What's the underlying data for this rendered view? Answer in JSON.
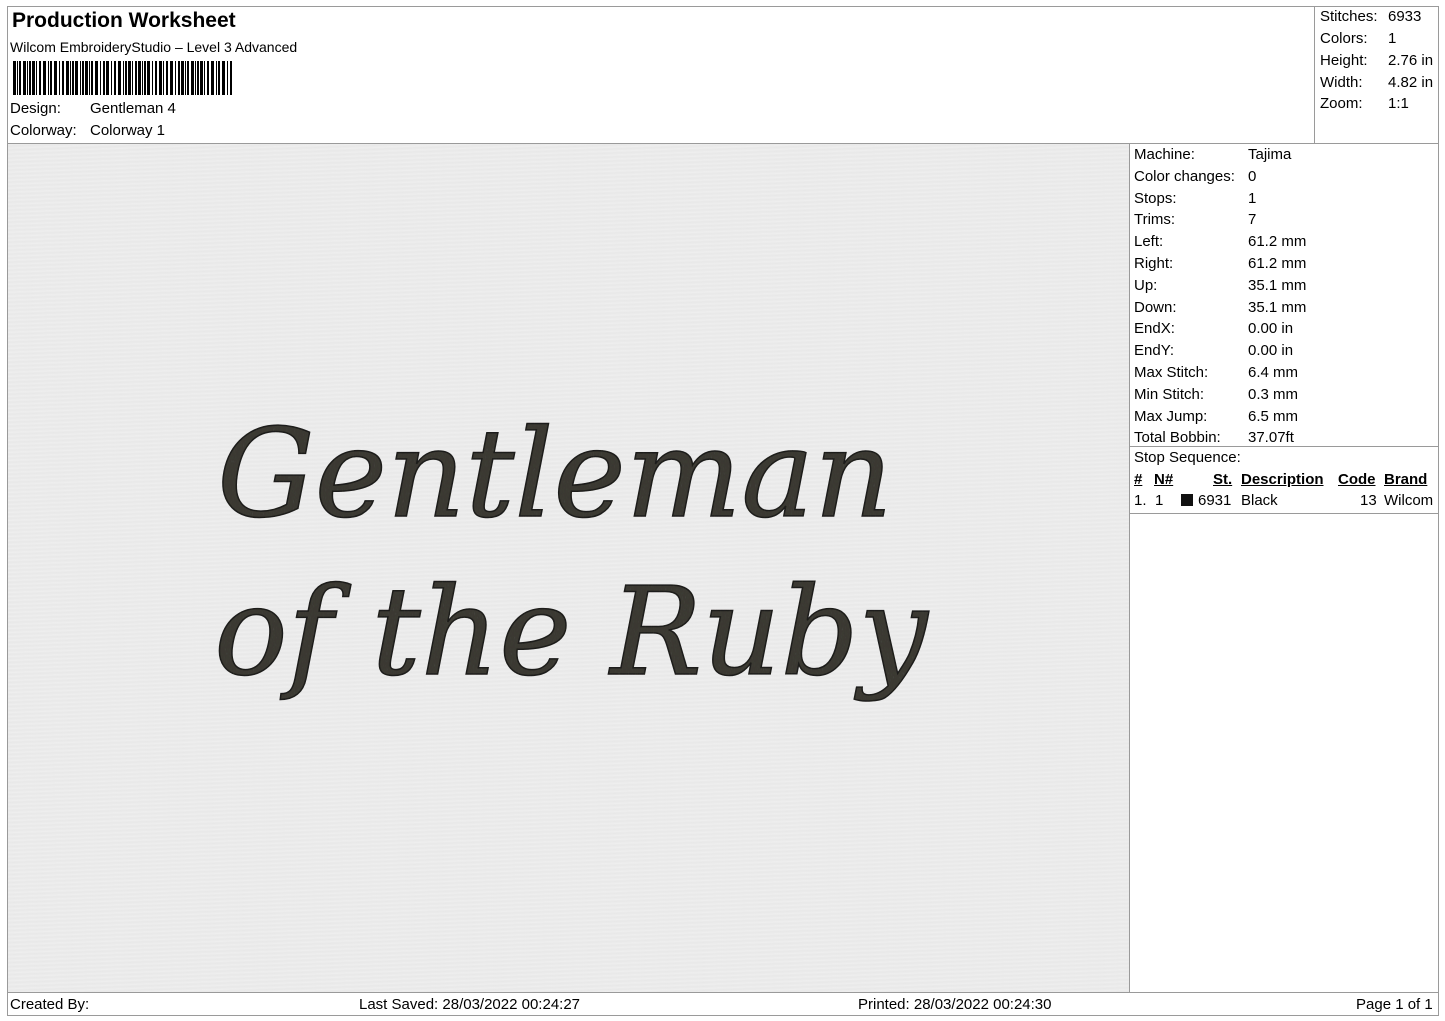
{
  "header": {
    "title": "Production Worksheet",
    "software": "Wilcom EmbroideryStudio – Level 3 Advanced",
    "design_label": "Design:",
    "design_value": "Gentleman 4",
    "colorway_label": "Colorway:",
    "colorway_value": "Colorway 1"
  },
  "summary": {
    "stitches_label": "Stitches:",
    "stitches": "6933",
    "colors_label": "Colors:",
    "colors": "1",
    "height_label": "Height:",
    "height": "2.76 in",
    "width_label": "Width:",
    "width": "4.82 in",
    "zoom_label": "Zoom:",
    "zoom": "1:1"
  },
  "design_text": {
    "line1": "Gentleman",
    "line2": "of the Ruby",
    "thread_color": "#3b3a33"
  },
  "machine_info": [
    {
      "label": "Machine:",
      "value": "Tajima"
    },
    {
      "label": "Color changes:",
      "value": "0"
    },
    {
      "label": "Stops:",
      "value": "1"
    },
    {
      "label": "Trims:",
      "value": "7"
    },
    {
      "label": "Left:",
      "value": "61.2 mm"
    },
    {
      "label": "Right:",
      "value": "61.2 mm"
    },
    {
      "label": "Up:",
      "value": "35.1 mm"
    },
    {
      "label": "Down:",
      "value": "35.1 mm"
    },
    {
      "label": "EndX:",
      "value": "0.00 in"
    },
    {
      "label": "EndY:",
      "value": "0.00 in"
    },
    {
      "label": "Max Stitch:",
      "value": "6.4 mm"
    },
    {
      "label": "Min Stitch:",
      "value": "0.3 mm"
    },
    {
      "label": "Max Jump:",
      "value": "6.5 mm"
    },
    {
      "label": "Total Bobbin:",
      "value": "37.07ft"
    }
  ],
  "stop_sequence": {
    "title": "Stop Sequence:",
    "headers": {
      "num": "#",
      "n": "N#",
      "st": "St.",
      "description": "Description",
      "code": "Code",
      "brand": "Brand"
    },
    "rows": [
      {
        "num": "1.",
        "n": "1",
        "swatch_color": "#111111",
        "st": "6931",
        "description": "Black",
        "code": "13",
        "brand": "Wilcom"
      }
    ]
  },
  "footer": {
    "created_by": "Created By:",
    "last_saved": "Last Saved: 28/03/2022 00:24:27",
    "printed": "Printed: 28/03/2022 00:24:30",
    "page": "Page 1 of 1"
  }
}
